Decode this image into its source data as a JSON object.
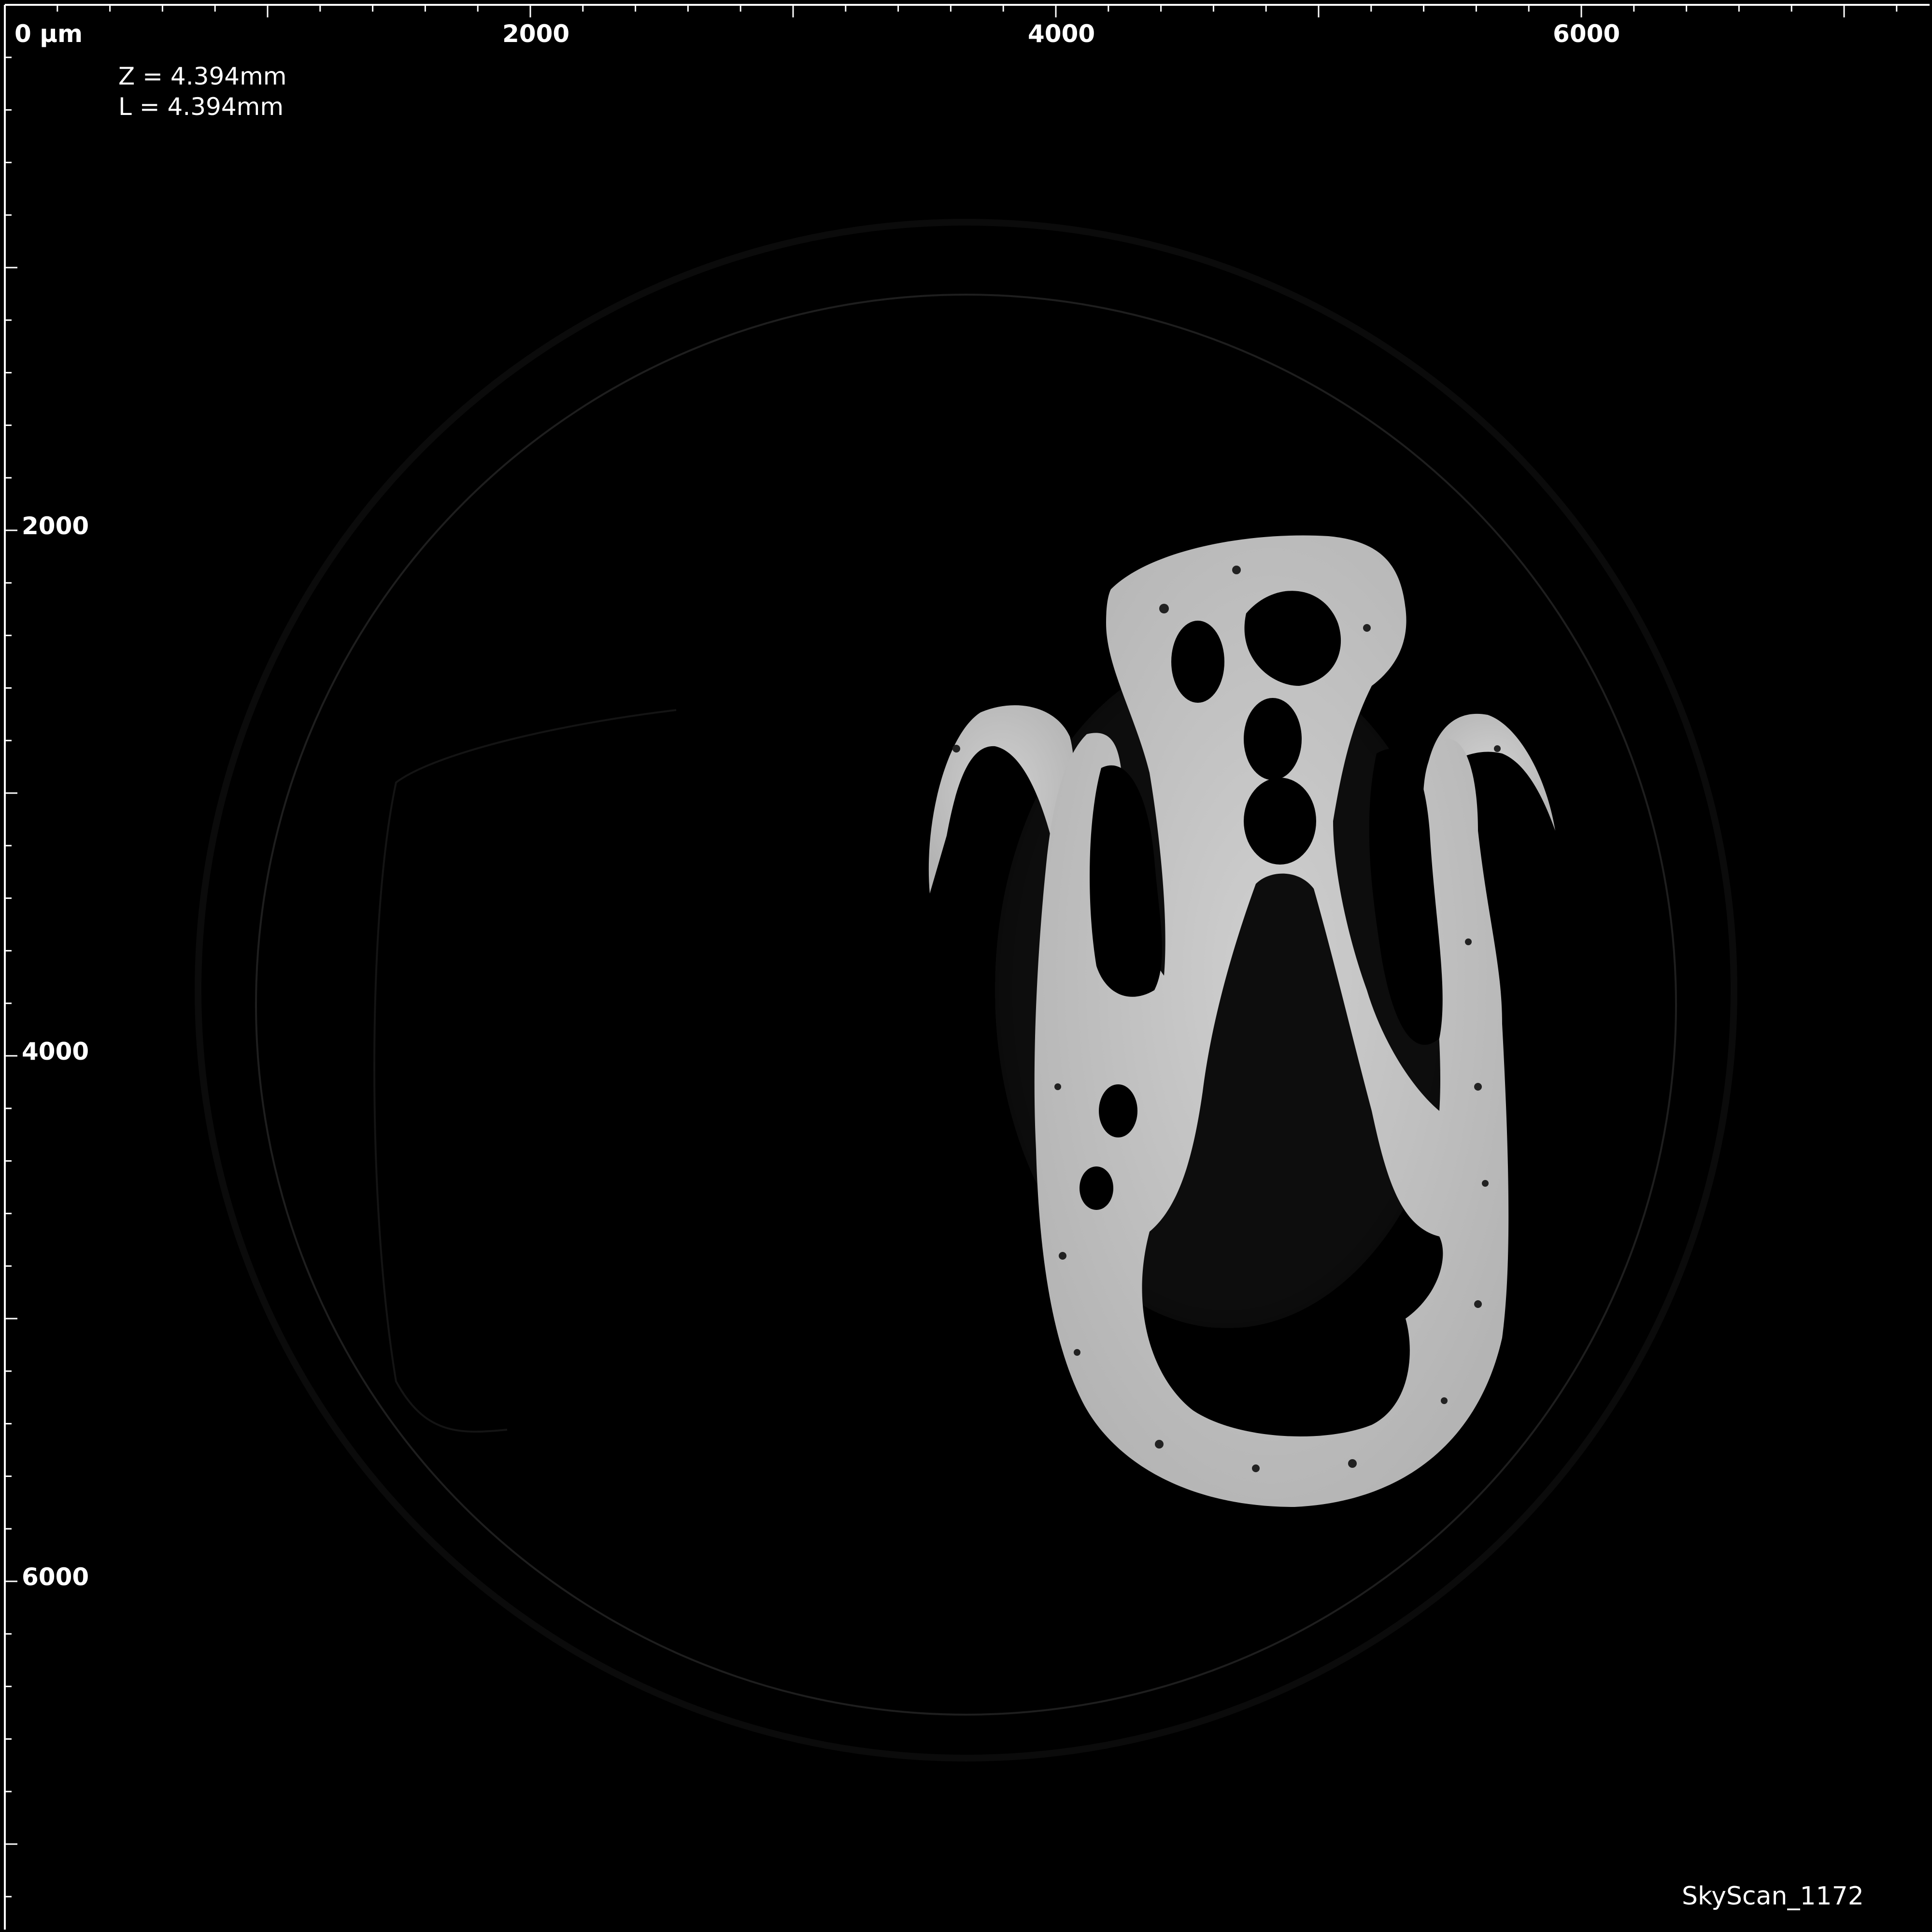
{
  "ruler": {
    "unit_label": "0 µm",
    "x_ticks": [
      {
        "value": 2000,
        "label": "2000"
      },
      {
        "value": 4000,
        "label": "4000"
      },
      {
        "value": 6000,
        "label": "6000"
      }
    ],
    "y_ticks": [
      {
        "value": 2000,
        "label": "2000"
      },
      {
        "value": 4000,
        "label": "4000"
      },
      {
        "value": 6000,
        "label": "6000"
      }
    ]
  },
  "info": {
    "z_line": "Z = 4.394mm",
    "l_line": "L = 4.394mm"
  },
  "scanner": {
    "name": "SkyScan_1172"
  },
  "colors": {
    "background": "#000000",
    "ruler": "#ffffff",
    "bone": "#c8c8c8",
    "field_of_view": "#1e1e1e"
  }
}
